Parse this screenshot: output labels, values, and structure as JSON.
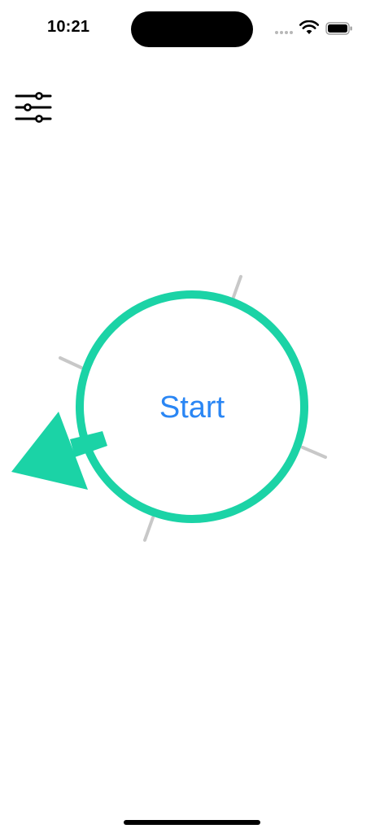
{
  "status_bar": {
    "time": "10:21"
  },
  "icons": {
    "settings": "sliders-icon",
    "wifi": "wifi-icon",
    "battery": "battery-icon",
    "signal": "cellular-signal-icon",
    "pointer": "arrow-pointer-icon"
  },
  "main": {
    "start_label": "Start"
  },
  "colors": {
    "accent": "#1bd3a6",
    "tick": "#c8c8c8",
    "start_text": "#2a86f4",
    "foreground": "#000000",
    "background": "#ffffff"
  }
}
